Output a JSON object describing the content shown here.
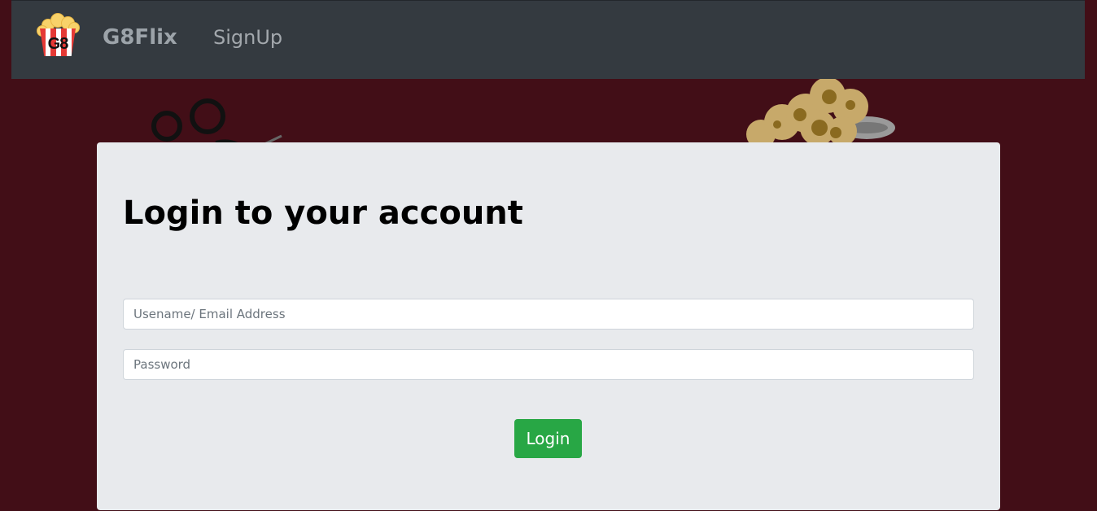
{
  "navbar": {
    "logo_text": "G8",
    "brand": "G8Flix",
    "signup_link": "SignUp"
  },
  "login_card": {
    "title": "Login to your account",
    "username": {
      "placeholder": "Usename/ Email Address",
      "value": ""
    },
    "password": {
      "placeholder": "Password",
      "value": ""
    },
    "login_label": "Login"
  },
  "colors": {
    "page_background": "#420e17",
    "navbar": "#343a40",
    "card": "#e8eaed",
    "login_button": "#28a745"
  }
}
